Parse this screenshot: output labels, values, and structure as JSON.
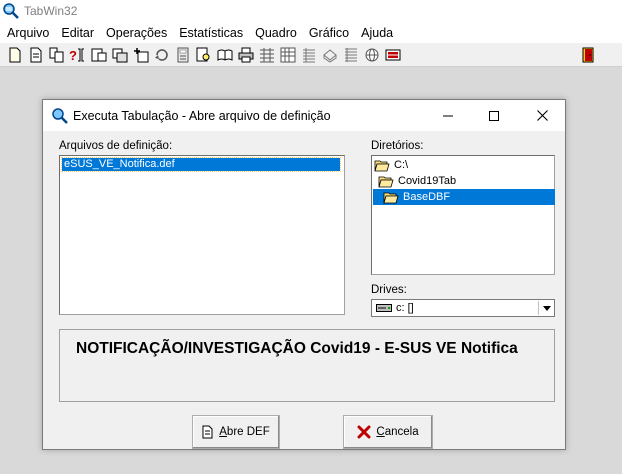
{
  "app": {
    "title": "TabWin32",
    "menu": [
      "Arquivo",
      "Editar",
      "Operações",
      "Estatísticas",
      "Quadro",
      "Gráfico",
      "Ajuda"
    ]
  },
  "toolbar": {
    "icons": [
      "new-file-icon",
      "open-file-icon",
      "copy-file-icon",
      "query-icon",
      "table-icon",
      "table-export-icon",
      "add-table-icon",
      "refresh-icon",
      "calculator-icon",
      "print-preview-icon",
      "book-icon",
      "print-icon",
      "grid-icon",
      "columns-icon",
      "list-icon",
      "chart-icon",
      "rows-icon",
      "globe-icon",
      "map-icon",
      "exit-door-icon"
    ]
  },
  "dialog": {
    "title": "Executa Tabulação - Abre arquivo de definição",
    "files_label": "Arquivos de definição:",
    "files": [
      "eSUS_VE_Notifica.def"
    ],
    "dirs_label": "Diretórios:",
    "dirs": [
      "C:\\",
      "Covid19Tab",
      "BaseDBF"
    ],
    "drives_label": "Drives:",
    "drive_value": "c: []",
    "description": "NOTIFICAÇÃO/INVESTIGAÇÃO Covid19 -  E-SUS VE Notifica",
    "open_button_accel": "A",
    "open_button_rest": "bre DEF",
    "cancel_button_accel": "C",
    "cancel_button_rest": "ancela"
  },
  "colors": {
    "selection": "#0078d7",
    "background": "#d9d9d9",
    "dialog_bg": "#f0f0f0"
  }
}
